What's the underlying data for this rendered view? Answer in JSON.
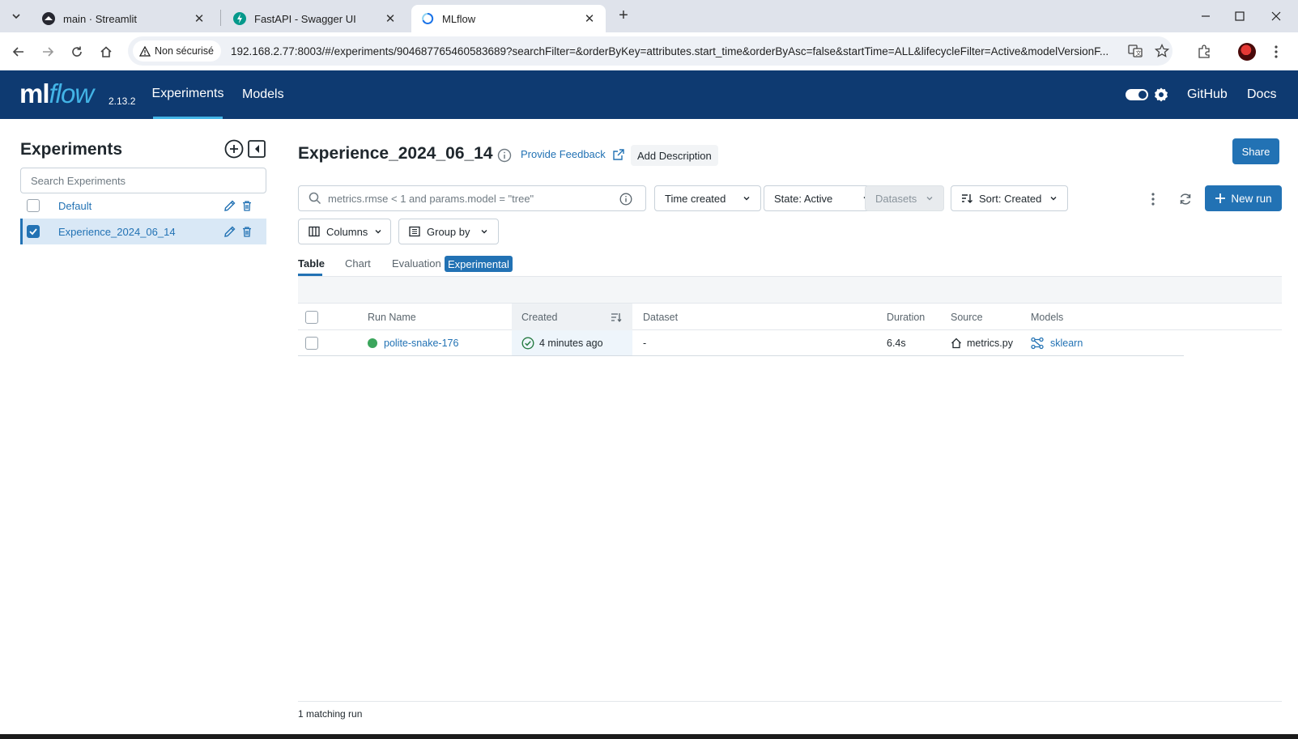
{
  "browser": {
    "tabs": [
      {
        "title": "main · Streamlit",
        "icon": "streamlit-icon"
      },
      {
        "title": "FastAPI - Swagger UI",
        "icon": "fastapi-icon"
      },
      {
        "title": "MLflow",
        "icon": "loading-icon",
        "active": true
      }
    ],
    "security_label": "Non sécurisé",
    "url": "192.168.2.77:8003/#/experiments/904687765460583689?searchFilter=&orderByKey=attributes.start_time&orderByAsc=false&startTime=ALL&lifecycleFilter=Active&modelVersionF..."
  },
  "header": {
    "logo_ml": "ml",
    "logo_flow": "flow",
    "version": "2.13.2",
    "nav": [
      "Experiments",
      "Models"
    ],
    "active_nav": "Experiments",
    "links": [
      "GitHub",
      "Docs"
    ],
    "brand_color": "#0e3a71",
    "accent_color": "#43b4e6"
  },
  "sidebar": {
    "title": "Experiments",
    "search_placeholder": "Search Experiments",
    "experiments": [
      {
        "name": "Default",
        "checked": false
      },
      {
        "name": "Experience_2024_06_14",
        "checked": true
      }
    ]
  },
  "main": {
    "title": "Experience_2024_06_14",
    "feedback_label": "Provide Feedback",
    "add_description_label": "Add Description",
    "share_label": "Share",
    "filter_placeholder": "metrics.rmse < 1 and params.model = \"tree\"",
    "time_created_label": "Time created",
    "state_label": "State: Active",
    "datasets_label": "Datasets",
    "sort_label": "Sort: Created",
    "new_run_label": "New run",
    "columns_label": "Columns",
    "group_by_label": "Group by",
    "view_tabs": [
      "Table",
      "Chart",
      "Evaluation"
    ],
    "experimental_badge": "Experimental",
    "table": {
      "columns": [
        "Run Name",
        "Created",
        "Dataset",
        "Duration",
        "Source",
        "Models"
      ],
      "rows": [
        {
          "run_name": "polite-snake-176",
          "status": "finished",
          "created": "4 minutes ago",
          "dataset": "-",
          "duration": "6.4s",
          "source": "metrics.py",
          "model": "sklearn"
        }
      ]
    },
    "footer": "1 matching run",
    "primary_color": "#2272b4",
    "status_color": "#3ba55c"
  }
}
